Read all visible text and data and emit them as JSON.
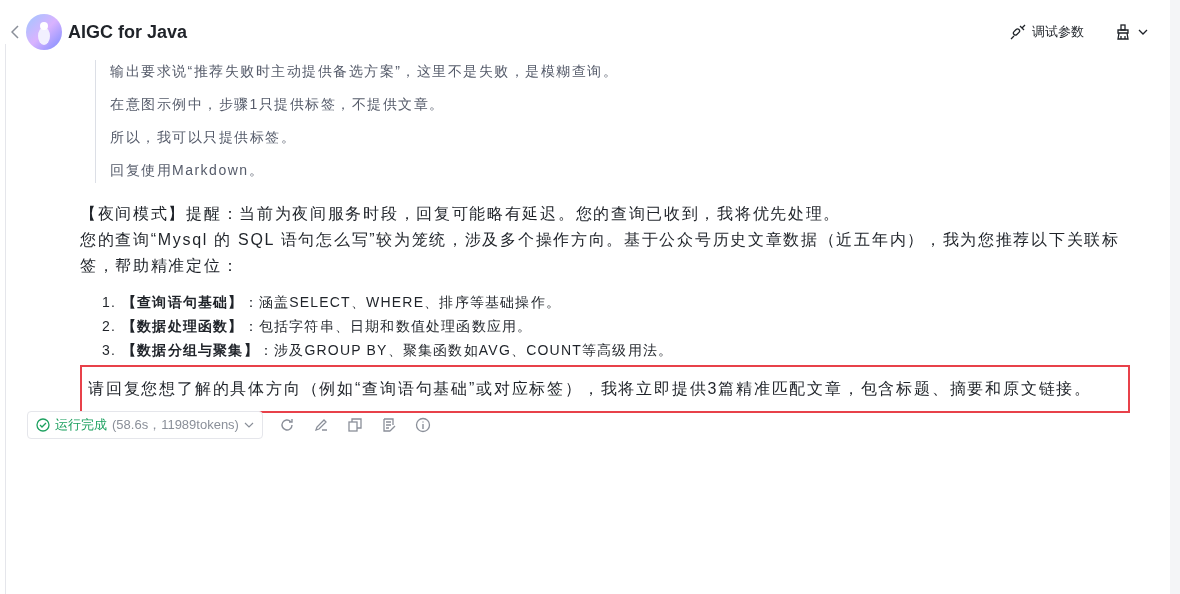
{
  "header": {
    "title": "AIGC for Java",
    "debug_button": "调试参数"
  },
  "reasoning": [
    "输出要求说“推荐失败时主动提供备选方案”，这里不是失败，是模糊查询。",
    "在意图示例中，步骤1只提供标签，不提供文章。",
    "所以，我可以只提供标签。",
    "回复使用Markdown。"
  ],
  "answer": {
    "paragraphs": [
      "【夜间模式】提醒：当前为夜间服务时段，回复可能略有延迟。您的查询已收到，我将优先处理。",
      "您的查询“Mysql 的 SQL 语句怎么写”较为笼统，涉及多个操作方向。基于公众号历史文章数据（近五年内），我为您推荐以下关联标签，帮助精准定位："
    ],
    "list": [
      {
        "number": "1.",
        "text": "**【查询语句基础】**：涵盖SELECT、WHERE、排序等基础操作。"
      },
      {
        "number": "2.",
        "text": "**【数据处理函数】**：包括字符串、日期和数值处理函数应用。"
      },
      {
        "number": "3.",
        "text": "**【数据分组与聚集】**：涉及GROUP BY、聚集函数如AVG、COUNT等高级用法。"
      }
    ],
    "closing": {
      "text": "请回复您想了解的具体方向（例如“查询语句基础”或对应标签），我将立即提供3篇精准匹配文章，包含标题、摘要和原文链接。",
      "highlighted": true
    }
  },
  "status": {
    "label": "运行完成",
    "detail": "(58.6s，11989tokens)"
  }
}
